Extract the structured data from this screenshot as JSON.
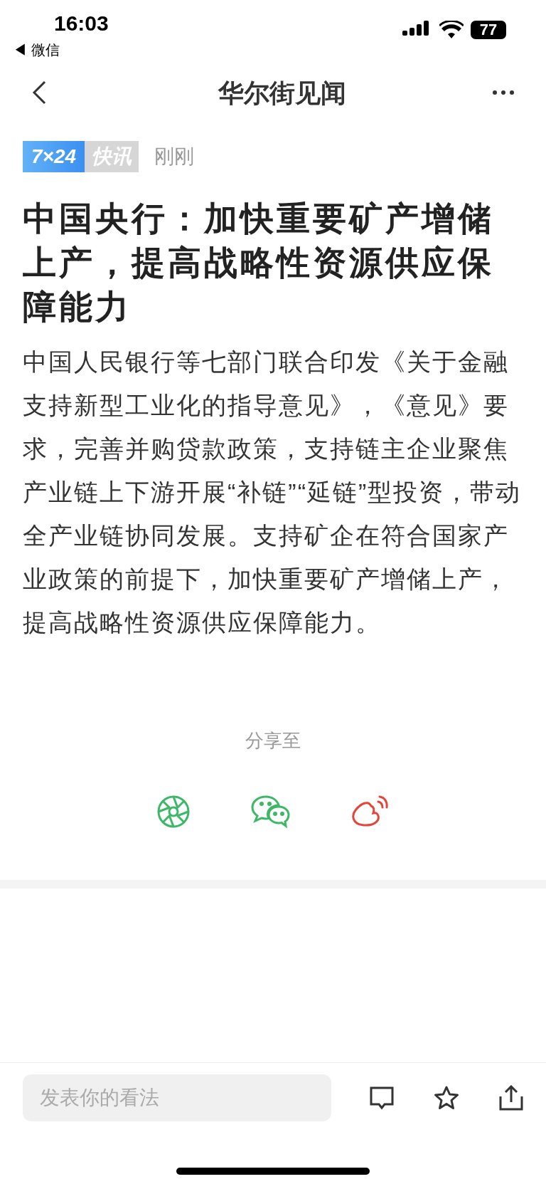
{
  "status_bar": {
    "time": "16:03",
    "back_app": "◀ 微信",
    "battery": "77"
  },
  "nav": {
    "title": "华尔街见闻"
  },
  "tag": {
    "part_1": "7×24",
    "part_2": "快讯"
  },
  "time": "刚刚",
  "headline": "中国央行：加快重要矿产增储上产，提高战略性资源供应保障能力",
  "body": "中国人民银行等七部门联合印发《关于金融支持新型工业化的指导意见》，《意见》要求，完善并购贷款政策，支持链主企业聚焦产业链上下游开展“补链”“延链”型投资，带动全产业链协同发展。支持矿企在符合国家产业政策的前提下，加快重要矿产增储上产，提高战略性资源供应保障能力。",
  "share": {
    "label": "分享至",
    "targets": [
      {
        "kind": "moments",
        "color": "#3cb867"
      },
      {
        "kind": "wechat",
        "color": "#3cb867"
      },
      {
        "kind": "weibo",
        "color": "#e5443b"
      }
    ]
  },
  "comment": {
    "placeholder": "发表你的看法"
  }
}
